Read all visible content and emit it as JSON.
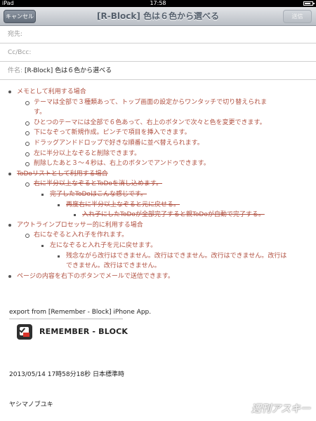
{
  "status_bar": {
    "carrier": "iPad",
    "wifi_icon": "wifi-icon",
    "time": "17:58",
    "battery_level": 0.8
  },
  "nav": {
    "cancel_label": "キャンセル",
    "title": "[R-Block] 色は６色から選べる",
    "send_label": "送信"
  },
  "fields": {
    "to_label": "宛先:",
    "cc_label": "Cc/Bcc:",
    "subject_label": "件名:",
    "subject_value": "[R-Block] 色は６色から選べる"
  },
  "outline": [
    {
      "text": "メモとして利用する場合",
      "level": 1,
      "strike": false
    },
    {
      "text": "テーマは全部で３種類あって、トップ画面の設定からワンタッチで切り替えられま",
      "level": 2,
      "strike": false
    },
    {
      "text": "す。",
      "level": 2,
      "strike": false,
      "continuation": true
    },
    {
      "text": "ひとつのテーマには全部で６色あって、右上のボタンで次々と色を変更できます。",
      "level": 2,
      "strike": false
    },
    {
      "text": "下になぞって新規作成。ピンチで項目を挿入できます。",
      "level": 2,
      "strike": false
    },
    {
      "text": "ドラッグアンドドロップで好きな順番に並べ替えられます。",
      "level": 2,
      "strike": false
    },
    {
      "text": "左に半分以上なぞると削除できます。",
      "level": 2,
      "strike": false
    },
    {
      "text": "削除したあと３〜４秒は、右上のボタンでアンドゥできます。",
      "level": 2,
      "strike": false
    },
    {
      "text": "ToDoリストとして利用する場合",
      "level": 1,
      "strike": true
    },
    {
      "text": "右に半分以上なぞるとToDoを消し込めます。",
      "level": 2,
      "strike": true
    },
    {
      "text": "完了したToDoはこんな感じです。",
      "level": 3,
      "strike": true
    },
    {
      "text": "再度右に半分以上なぞると元に戻せる。",
      "level": 4,
      "strike": true
    },
    {
      "text": "入れ子にしたToDoが全部完了すると親ToDoが自動で完了する。",
      "level": 5,
      "strike": true
    },
    {
      "text": "アウトラインプロセッサー的に利用する場合",
      "level": 1,
      "strike": false
    },
    {
      "text": "右になぞると入れ子を作れます。",
      "level": 2,
      "strike": false
    },
    {
      "text": "左になぞると入れ子を元に戻せます。",
      "level": 3,
      "strike": false
    },
    {
      "text": "残念ながら改行はできません。改行はできません。改行はできません。改行は",
      "level": 4,
      "strike": false
    },
    {
      "text": "できません。改行はできません。",
      "level": 4,
      "strike": false,
      "continuation": true
    },
    {
      "text": "ページの内容を右下のボタンでメールで送信できます。",
      "level": 1,
      "strike": false
    }
  ],
  "export_text": "export from [Remember - Block] iPhone App.",
  "brand_name": "REMEMBER - BLOCK",
  "datetime": "2013/05/14 17時58分18秒 日本標準時",
  "signature": "ヤシマノブユキ",
  "watermark": "週刊アスキー",
  "colors": {
    "item_text": "#b05040",
    "nav_title": "#55606d"
  }
}
